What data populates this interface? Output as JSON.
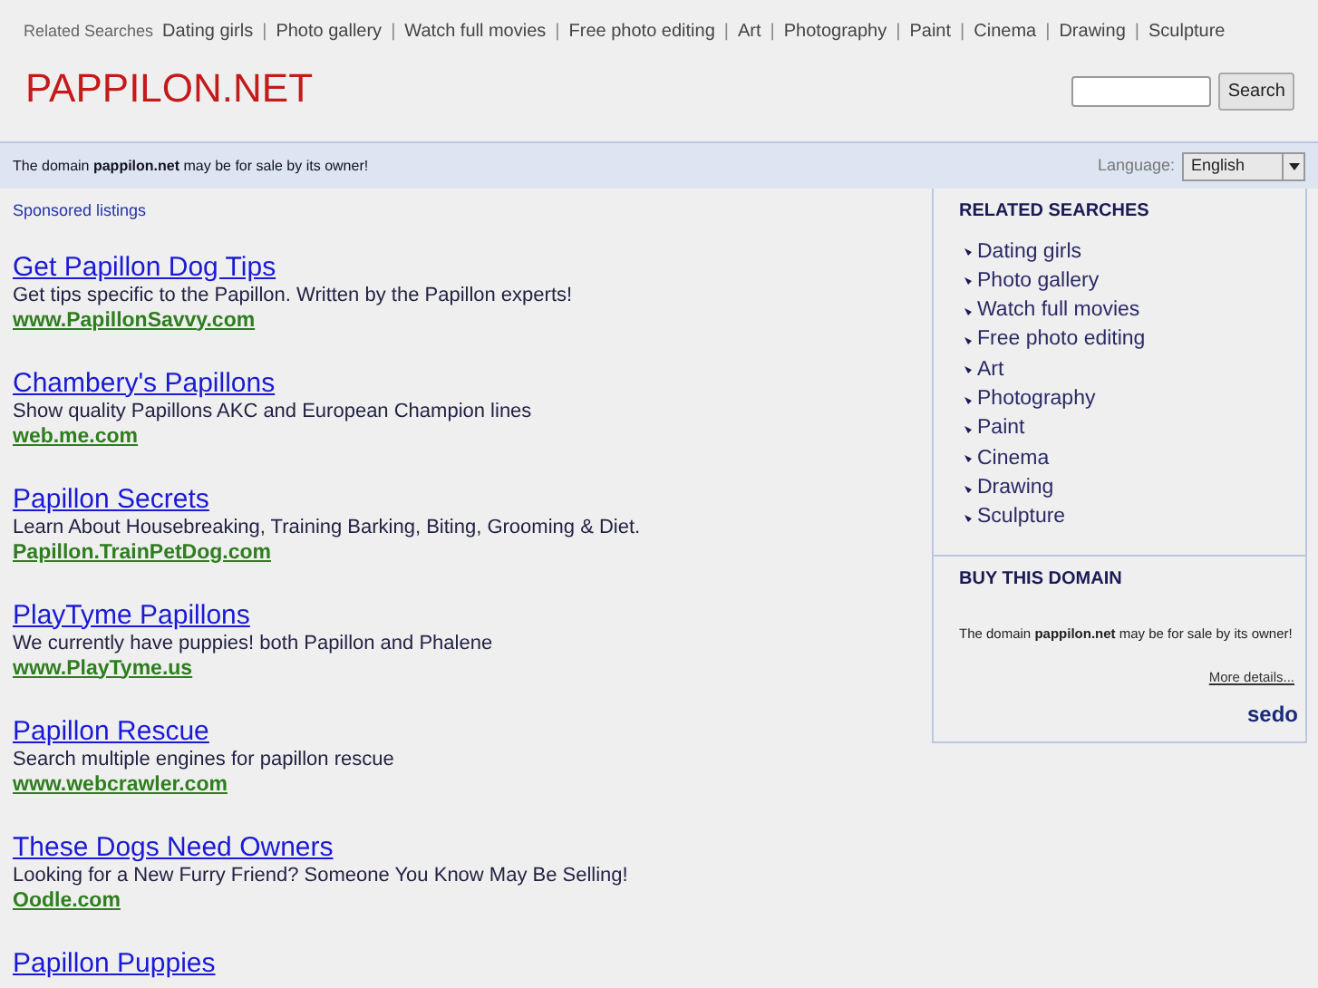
{
  "top_related": {
    "label": "Related Searches",
    "links": [
      "Dating girls",
      "Photo gallery",
      "Watch full movies",
      "Free photo editing",
      "Art",
      "Photography",
      "Paint",
      "Cinema",
      "Drawing",
      "Sculpture"
    ],
    "separator": "|"
  },
  "site_title": "PAPPILON.NET",
  "search": {
    "button": "Search"
  },
  "notice_bar": {
    "text": "The domain **pappilon.net** may be for sale by its owner!",
    "language_label": "Language:",
    "language": "English"
  },
  "sponsored_label": "Sponsored listings",
  "ads": [
    {
      "title": "Get Papillon Dog Tips",
      "description": "Get tips specific to the Papillon. Written by the Papillon experts!",
      "url": "www.PapillonSavvy.com"
    },
    {
      "title": "Chambery's Papillons",
      "description": "Show quality Papillons AKC and European Champion lines",
      "url": "web.me.com"
    },
    {
      "title": "Papillon Secrets",
      "description": "Learn About Housebreaking, Training Barking, Biting, Grooming & Diet.",
      "url": "Papillon.TrainPetDog.com"
    },
    {
      "title": "PlayTyme Papillons",
      "description": "We currently have puppies! both Papillon and Phalene",
      "url": "www.PlayTyme.us"
    },
    {
      "title": "Papillon Rescue",
      "description": "Search multiple engines for papillon rescue",
      "url": "www.webcrawler.com"
    },
    {
      "title": "These Dogs Need Owners",
      "description": "Looking for a New Furry Friend? Someone You Know May Be Selling!",
      "url": "Oodle.com"
    },
    {
      "title": "Papillon Puppies"
    }
  ],
  "sidebar": {
    "related_title": "RELATED SEARCHES",
    "related": [
      "Dating girls",
      "Photo gallery",
      "Watch full movies",
      "Free photo editing",
      "Art",
      "Photography",
      "Paint",
      "Cinema",
      "Drawing",
      "Sculpture"
    ],
    "buy_title": "BUY THIS DOMAIN",
    "buy_text": "The domain **pappilon.net** may be for sale by its owner!",
    "more_link": "More details...",
    "logo_text": "sedo"
  }
}
